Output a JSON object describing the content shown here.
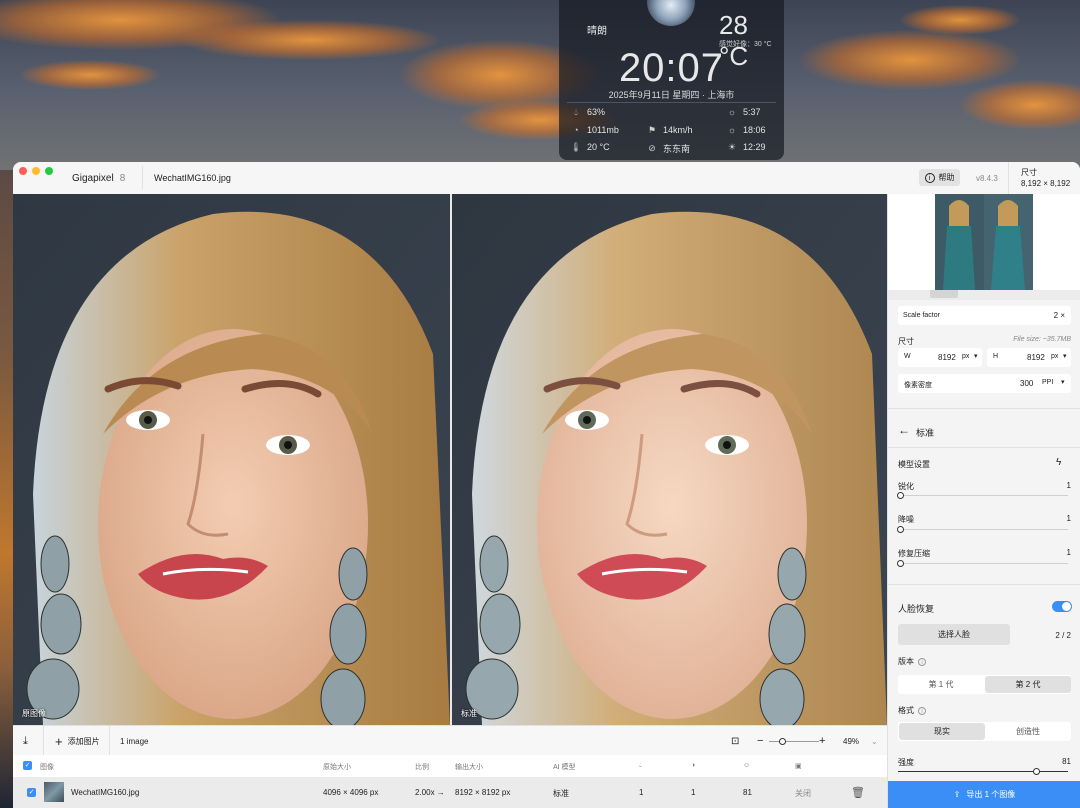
{
  "weather": {
    "condition": "晴朗",
    "temperature": "28 °C",
    "feels_like": "感觉好像：30 °C",
    "time": "20:07",
    "date": "2025年9月11日 星期四 · 上海市",
    "humidity": "63%",
    "pressure": "1011mb",
    "dew_point": "20 °C",
    "wind_speed": "14km/h",
    "wind_dir": "东东南",
    "sunrise": "5:37",
    "sunset": "18:06",
    "noon": "12:29"
  },
  "window": {
    "app_name": "Gigapixel",
    "app_version_badge": "8",
    "file_name": "WechatIMG160.jpg",
    "help_label": "帮助",
    "version": "v8.4.3",
    "size_label": "尺寸",
    "size_value": "8,192 × 8,192"
  },
  "preview": {
    "left_label": "原图像",
    "right_label": "标准"
  },
  "panel": {
    "scale_label": "Scale factor",
    "scale_value": "2 ×",
    "dims_label": "尺寸",
    "file_size": "File size: ~35.7MB",
    "w_label": "W",
    "w_value": "8192",
    "w_unit": "px",
    "h_label": "H",
    "h_value": "8192",
    "h_unit": "px",
    "density_label": "像素密度",
    "density_value": "300",
    "density_unit": "PPI",
    "back_title": "标准",
    "model_settings": "模型设置",
    "sliders": [
      {
        "label": "锐化",
        "value": "1",
        "level": 0.0
      },
      {
        "label": "降噪",
        "value": "1",
        "level": 0.0
      },
      {
        "label": "修复压缩",
        "value": "1",
        "level": 0.0
      }
    ],
    "face_recovery": "人脸恢复",
    "face_recovery_enabled": true,
    "select_face": "选择人脸",
    "face_count": "2 / 2",
    "version_label": "版本",
    "version_options": [
      "第 1 代",
      "第 2 代"
    ],
    "version_selected": "第 2 代",
    "style_label": "格式",
    "style_options": [
      "现实",
      "创造性"
    ],
    "style_selected": "现实",
    "strength_label": "强度",
    "strength_value": "81",
    "export_label": "导出 1 个图像"
  },
  "toolbar": {
    "add_images": "添加图片",
    "image_count": "1 image",
    "zoom": "49%"
  },
  "table": {
    "headers": [
      "图像",
      "原始大小",
      "比例",
      "输出大小",
      "AI 模型"
    ],
    "row": {
      "name": "WechatIMG160.jpg",
      "original_size": "4096 × 4096 px",
      "scale": "2.00x →",
      "output_size": "8192 × 8192 px",
      "model": "标准",
      "sharpen": "1",
      "denoise": "1",
      "face": "81",
      "status": "关闭"
    }
  },
  "colors": {
    "accent": "#3b8ef5"
  }
}
